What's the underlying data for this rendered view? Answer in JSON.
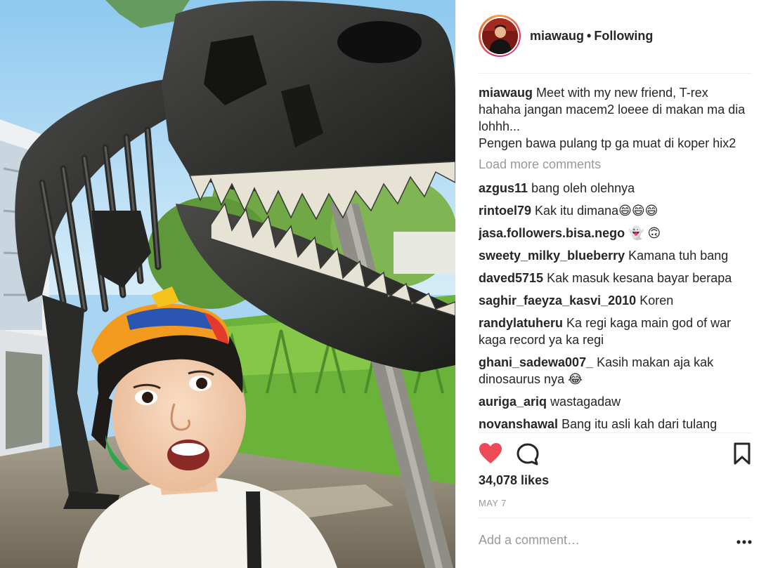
{
  "header": {
    "username": "miawaug",
    "separator": "•",
    "follow_status": "Following"
  },
  "caption": {
    "username": "miawaug",
    "lines": [
      "Meet with my new friend, T-rex hahaha jangan macem2 loeee di makan ma dia lohhh...",
      "Pengen bawa pulang tp ga muat di koper hix2"
    ]
  },
  "load_more_label": "Load more comments",
  "comments": [
    {
      "user": "azgus11",
      "text": "bang oleh olehnya"
    },
    {
      "user": "rintoel79",
      "text": "Kak itu dimana😄😄😄"
    },
    {
      "user": "jasa.followers.bisa.nego",
      "text": "👻 🙃"
    },
    {
      "user": "sweety_milky_blueberry",
      "text": "Kamana tuh bang"
    },
    {
      "user": "daved5715",
      "text": "Kak masuk kesana bayar berapa"
    },
    {
      "user": "saghir_faeyza_kasvi_2010",
      "text": "Koren"
    },
    {
      "user": "randylatuheru",
      "text": "Ka regi kaga main god of war kaga record ya ka regi"
    },
    {
      "user": "ghani_sadewa007_",
      "text": "Kasih makan aja kak dinosaurus nya 😂"
    },
    {
      "user": "auriga_ariq",
      "text": "wastagadaw"
    },
    {
      "user": "novanshawal",
      "text": "Bang itu asli kah dari tulang"
    }
  ],
  "actions": {
    "like_icon": "heart-filled-icon",
    "comment_icon": "speech-bubble-icon",
    "save_icon": "bookmark-icon",
    "like_color": "#ed4956"
  },
  "likes_text": "34,078 likes",
  "date_text": "MAY 7",
  "add_comment_placeholder": "Add a comment…",
  "more_icon": "ellipsis-icon"
}
